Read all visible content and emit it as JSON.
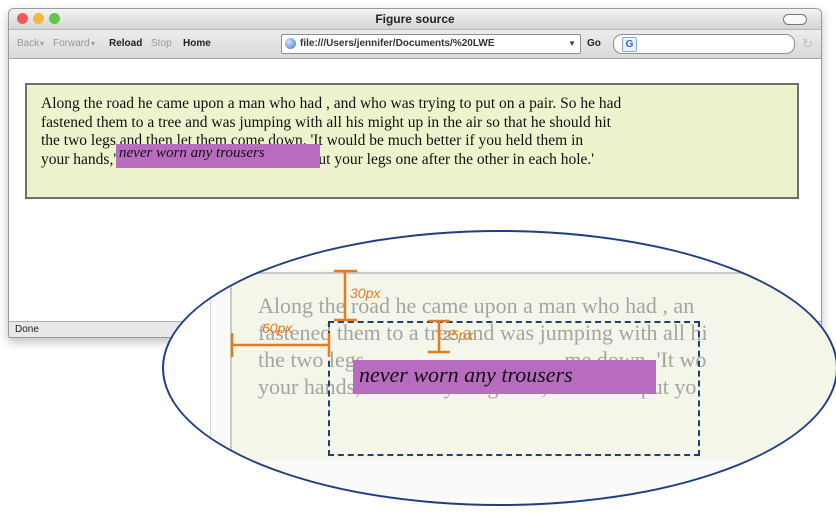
{
  "window": {
    "title": "Figure source",
    "traffic_lights": [
      "#ee5b55",
      "#f3b73d",
      "#62c54a"
    ]
  },
  "toolbar": {
    "back": "Back",
    "forward": "Forward",
    "reload": "Reload",
    "stop": "Stop",
    "home": "Home",
    "url": "file:///Users/jennifer/Documents/%20LWE",
    "go": "Go",
    "search_logo": "G"
  },
  "page": {
    "paragraph_line1": "Along the road he came upon a man who had , and who was trying to put on a pair. So he had",
    "paragraph_line2": "fastened them to a tree and was jumping with all his might up in the air so that he should hit",
    "paragraph_line3": "the two legs and then let them come down. 'It would be much better if you held them in",
    "paragraph_line4": "your hands,' said the young man, `and then put your legs one after the other in each hole.'",
    "float_text": "never worn any trousers"
  },
  "status": {
    "text": "Done"
  },
  "zoom": {
    "lines": [
      "Along the road he came upon a man who had , an",
      "fastened them to a tree and was jumping with all hi",
      "the two legs",
      "your hands,' said the young man, `and then put yo"
    ],
    "line3_tail": "me down. 'It wo",
    "float_text": "never worn any trousers"
  },
  "annotations": {
    "top_margin_label": "30px",
    "inner_offset_label": "25px",
    "left_margin_label": "60px"
  },
  "colors": {
    "page_background": "#eef3cd",
    "float_background": "#b86cc0",
    "annotation_orange": "#e67a1c",
    "outline_blue": "#1e3f80"
  }
}
